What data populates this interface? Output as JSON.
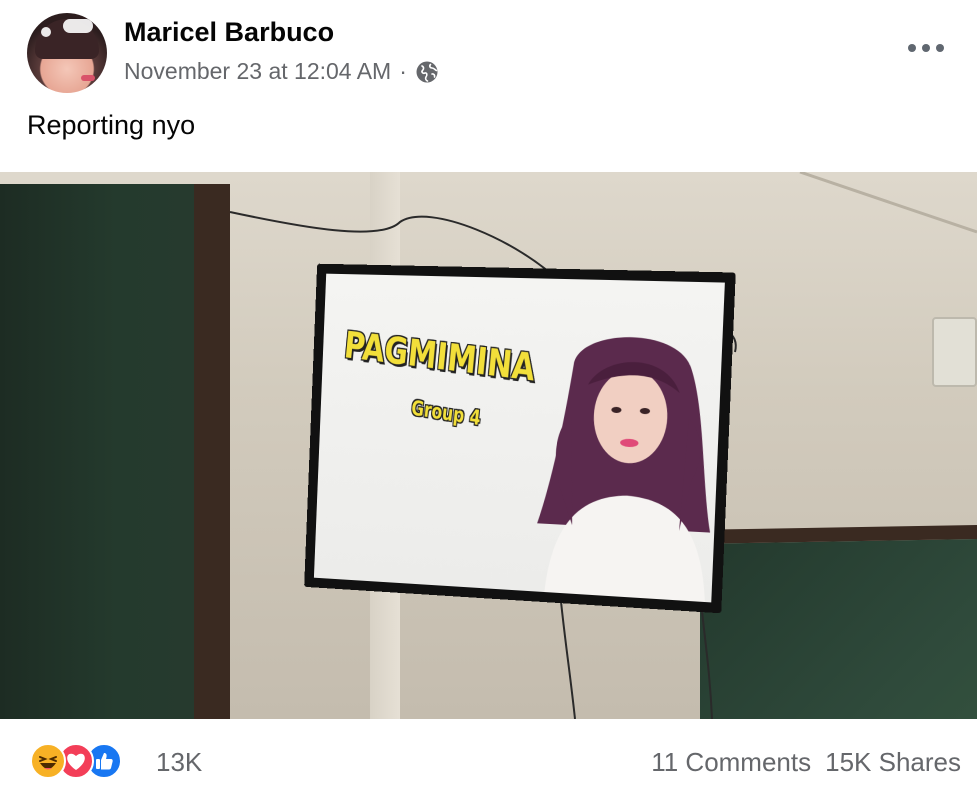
{
  "post": {
    "author": "Maricel Barbuco",
    "timestamp": "November 23 at 12:04 AM",
    "separator": "·",
    "privacy_icon": "globe-icon",
    "more_icon": "more-options-icon",
    "text": "Reporting nyo"
  },
  "photo": {
    "slide_title": "PAGMIMINA",
    "slide_subtitle": "Group 4"
  },
  "engagement": {
    "reaction_icons": [
      "haha-icon",
      "love-icon",
      "like-icon"
    ],
    "reaction_count": "13K",
    "comments": "11 Comments",
    "shares": "15K Shares"
  },
  "colors": {
    "secondary_text": "#65676b",
    "like_blue": "#1877f2",
    "love_red": "#f33e58",
    "haha_yellow": "#f7b125"
  }
}
